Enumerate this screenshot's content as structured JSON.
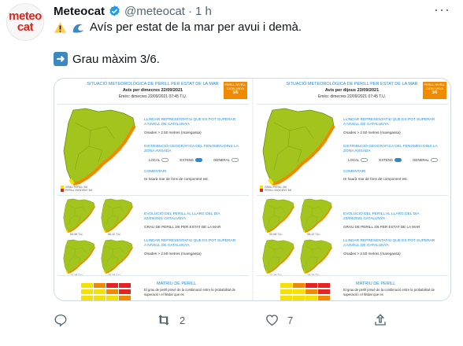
{
  "tweet": {
    "avatar_line1": "meteo",
    "avatar_line2": "cat",
    "display_name": "Meteocat",
    "handle": "@meteocat",
    "separator": "·",
    "time": "1 h",
    "text_line1": "Avís per estat de la mar per avui i demà.",
    "text_line2": "Grau màxim 3/6.",
    "icons": {
      "warning": "warning-icon",
      "wave": "water-wave-icon",
      "arrow": "right-arrow-icon"
    },
    "colors": {
      "brand": "#d9261c",
      "verified": "#1d9bf0",
      "muted": "#536471",
      "map_green": "#a3c41c",
      "map_yellow": "#f5e100",
      "map_orange": "#f08a00",
      "map_red": "#e52320"
    }
  },
  "panels": [
    {
      "title": "SITUACIÓ METEOROLÒGICA DE PERILL PER ESTAT DE LA MAR",
      "date": "Avís per dimecres 22/09/2021",
      "emitted": "Emès: dimecres 22/09/2021 07:45 T.U.",
      "badge_top": "PERILL NIVELL CATALUNYA",
      "badge_value": "3/6",
      "threshold_title": "LLINDAR REPRESENTATIU QUE ES POT SUPERAR A NIVELL DE CATALUNYA",
      "threshold_value": "Onades > 2.50 metres (maregassa)",
      "distribution_title": "DISTRIBUCIÓ GEOGRÀFICA DEL FENOMEN DINS LA ZONA AVISADA",
      "radio_local": "LOCAL",
      "radio_extens": "EXTENS",
      "radio_general": "GENERAL",
      "comment_title": "COMENTARI",
      "comment_text": "Hi haurà mar de fons de component est.",
      "legend_a": "GRAU PERILL 3/6",
      "legend_b": "PERILL INCIDENT 3/6",
      "evolution_title": "EVOLUCIÓ DEL PERILL AL LLARG DEL DIA 22/09/2021 CATALUNYA",
      "evolution_value": "GRAU DE PERILL 3/6 PER ESTAT DE LA MAR",
      "threshold2_title": "LLINDAR REPRESENTATIU QUE ES POT SUPERAR A NIVELL DE CATALUNYA",
      "threshold2_value": "Onades > 2.50 metres (maregassa)",
      "matrix_title": "MATRIU DE PERILL",
      "matrix_text": "El grau de perill prové de la combinació entre la probabilitat de superació i el llindar que es",
      "small_labels": [
        "00-06 T.U.",
        "06-12 T.U.",
        "12-18 T.U.",
        "18-24 T.U."
      ]
    },
    {
      "title": "SITUACIÓ METEOROLÒGICA DE PERILL PER ESTAT DE LA MAR",
      "date": "Avís per dijous 23/09/2021",
      "emitted": "Emès: dimecres 22/09/2021 07:45 T.U.",
      "badge_top": "PERILL NIVELL CATALUNYA",
      "badge_value": "3/6",
      "threshold_title": "LLINDAR REPRESENTATIU QUE ES POT SUPERAR A NIVELL DE CATALUNYA",
      "threshold_value": "Onades > 2.50 metres (maregassa)",
      "distribution_title": "DISTRIBUCIÓ GEOGRÀFICA DEL FENOMEN DINS LA ZONA AVISADA",
      "radio_local": "LOCAL",
      "radio_extens": "EXTENS",
      "radio_general": "GENERAL",
      "comment_title": "COMENTARI",
      "comment_text": "Hi haurà mar de fons de component est.",
      "legend_a": "GRAU PERILL 3/6",
      "legend_b": "PERILL INCIDENT 3/6",
      "evolution_title": "EVOLUCIÓ DEL PERILL AL LLARG DEL DIA 23/09/2021 CATALUNYA",
      "evolution_value": "GRAU DE PERILL 3/6 PER ESTAT DE LA MAR",
      "threshold2_title": "LLINDAR REPRESENTATIU QUE ES POT SUPERAR A NIVELL DE CATALUNYA",
      "threshold2_value": "Onades > 2.50 metres (maregassa)",
      "matrix_title": "MATRIU DE PERILL",
      "matrix_text": "El grau de perill prové de la combinació entre la probabilitat de superació i el llindar que es",
      "small_labels": [
        "00-06 T.U.",
        "06-12 T.U.",
        "12-18 T.U.",
        "18-24 T.U."
      ]
    }
  ],
  "actions": {
    "reply_icon": "reply-icon",
    "retweet_icon": "retweet-icon",
    "retweet_count": "2",
    "like_icon": "heart-icon",
    "like_count": "7",
    "share_icon": "share-icon"
  }
}
